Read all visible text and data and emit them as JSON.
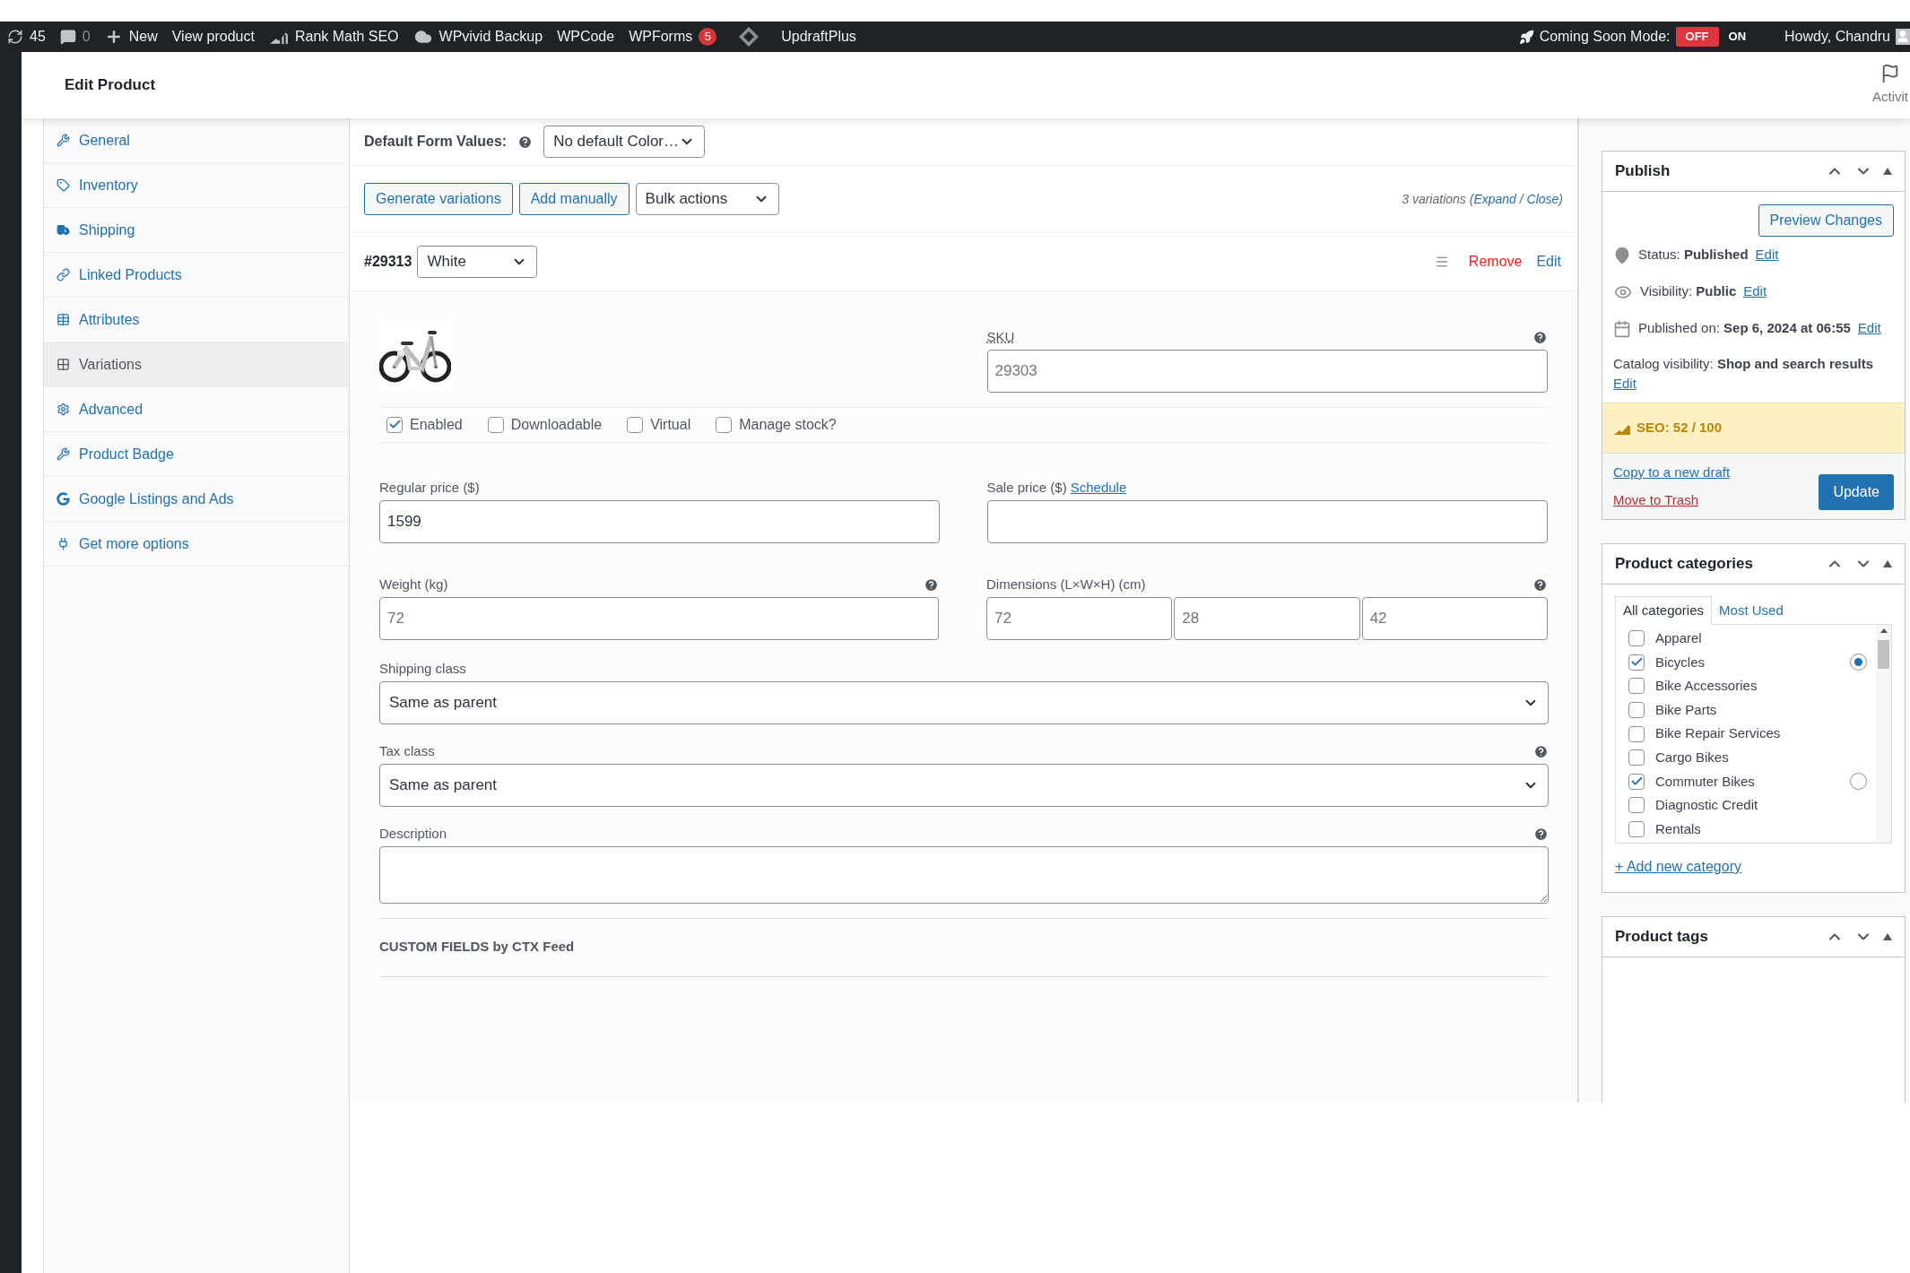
{
  "admin_bar": {
    "items": [
      {
        "kind": "updates",
        "label": "45"
      },
      {
        "kind": "comments",
        "label": "0"
      },
      {
        "kind": "new",
        "label": "New"
      },
      {
        "kind": "text",
        "label": "View product"
      },
      {
        "kind": "rankmath",
        "label": "Rank Math SEO"
      },
      {
        "kind": "cloud",
        "label": "WPvivid Backup"
      },
      {
        "kind": "text",
        "label": "WPCode"
      },
      {
        "kind": "text",
        "label": "WPForms",
        "badge": "5"
      },
      {
        "kind": "diamond"
      },
      {
        "kind": "text",
        "label": "UpdraftPlus"
      }
    ],
    "coming_soon": {
      "label": "Coming Soon Mode:",
      "options": [
        {
          "label": "OFF",
          "selected": true
        },
        {
          "label": "ON",
          "selected": false
        }
      ]
    },
    "account": "Howdy, Chandru"
  },
  "header": {
    "title": "Edit Product",
    "activity": "Activit"
  },
  "product_tabs": [
    {
      "label": "General",
      "selected": false
    },
    {
      "label": "Inventory",
      "selected": false
    },
    {
      "label": "Shipping",
      "selected": false
    },
    {
      "label": "Linked Products",
      "selected": false
    },
    {
      "label": "Attributes",
      "selected": false
    },
    {
      "label": "Variations",
      "selected": true
    },
    {
      "label": "Advanced",
      "selected": false
    },
    {
      "label": "Product Badge",
      "selected": false
    },
    {
      "label": "Google Listings and Ads",
      "selected": false
    },
    {
      "label": "Get more options",
      "selected": false
    }
  ],
  "variations": {
    "default_form_values": {
      "label": "Default Form Values:",
      "value": "No default Color…"
    },
    "buttons": [
      "Generate variations",
      "Add manually"
    ],
    "bulk_actions": "Bulk actions",
    "summary": [
      {
        "kind": "text",
        "text": "3 variations ("
      },
      {
        "kind": "link",
        "text": "Expand"
      },
      {
        "kind": "text",
        "text": " / "
      },
      {
        "kind": "link",
        "text": "Close"
      },
      {
        "kind": "text",
        "text": ")"
      }
    ],
    "variation": {
      "id": "#29313",
      "attribute": "White",
      "remove": "Remove",
      "edit": "Edit",
      "sku": {
        "label": "SKU",
        "placeholder": "29303"
      },
      "options": [
        {
          "label": "Enabled",
          "checked": true
        },
        {
          "label": "Downloadable",
          "checked": false
        },
        {
          "label": "Virtual",
          "checked": false
        },
        {
          "label": "Manage stock?",
          "checked": false
        }
      ],
      "regular_price": {
        "label": "Regular price ($)",
        "value": "1599"
      },
      "sale_price": {
        "label": "Sale price ($)",
        "link": "Schedule"
      },
      "weight": {
        "label": "Weight (kg)",
        "placeholder": "72"
      },
      "dimensions": {
        "label": "Dimensions (L×W×H) (cm)",
        "placeholders": [
          "72",
          "28",
          "42"
        ]
      },
      "shipping_class": {
        "label": "Shipping class",
        "value": "Same as parent"
      },
      "tax_class": {
        "label": "Tax class",
        "value": "Same as parent"
      },
      "description": {
        "label": "Description"
      },
      "custom_fields": "CUSTOM FIELDS by CTX Feed"
    }
  },
  "publish": {
    "title": "Publish",
    "preview": "Preview Changes",
    "rows": [
      {
        "label": "Status:",
        "value": "Published",
        "link": "Edit"
      },
      {
        "label": "Visibility:",
        "value": "Public",
        "link": "Edit"
      },
      {
        "label": "Published on:",
        "value": "Sep 6, 2024 at 06:55",
        "link": "Edit"
      }
    ],
    "catalog": {
      "label": "Catalog visibility:",
      "value": "Shop and search results",
      "link": "Edit"
    },
    "seo": "SEO: 52 / 100",
    "copy": "Copy to a new draft",
    "trash": "Move to Trash",
    "update": "Update"
  },
  "categories": {
    "title": "Product categories",
    "tabs": [
      {
        "label": "All categories",
        "selected": true
      },
      {
        "label": "Most Used",
        "selected": false
      }
    ],
    "items": [
      {
        "label": "Apparel",
        "checked": false
      },
      {
        "label": "Bicycles",
        "checked": true,
        "primary": true
      },
      {
        "label": "Bike Accessories",
        "checked": false
      },
      {
        "label": "Bike Parts",
        "checked": false
      },
      {
        "label": "Bike Repair Services",
        "checked": false
      },
      {
        "label": "Cargo Bikes",
        "checked": false
      },
      {
        "label": "Commuter Bikes",
        "checked": true,
        "primary": false
      },
      {
        "label": "Diagnostic Credit",
        "checked": false
      },
      {
        "label": "Rentals",
        "checked": false
      }
    ],
    "add": "+ Add new category"
  },
  "tags": {
    "title": "Product tags"
  }
}
